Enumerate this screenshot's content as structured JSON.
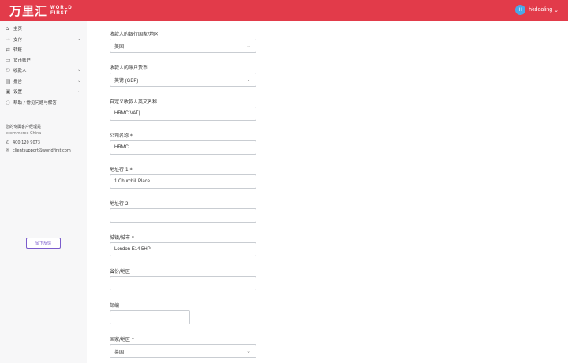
{
  "brand": {
    "cn": "万里汇",
    "en_line1": "WORLD",
    "en_line2": "FIRST"
  },
  "user": {
    "initial": "H",
    "name": "hkdealing"
  },
  "sidebar": {
    "items": [
      {
        "label": "主页",
        "icon": "home-icon",
        "glyph": "⌂",
        "has_arrow": false
      },
      {
        "label": "支付",
        "icon": "arrow-right-icon",
        "glyph": "→",
        "has_arrow": true
      },
      {
        "label": "转账",
        "icon": "transfer-icon",
        "glyph": "⇄",
        "has_arrow": false
      },
      {
        "label": "货币账户",
        "icon": "wallet-icon",
        "glyph": "▭",
        "has_arrow": false
      },
      {
        "label": "收款人",
        "icon": "person-icon",
        "glyph": "⚇",
        "has_arrow": true
      },
      {
        "label": "报告",
        "icon": "report-icon",
        "glyph": "▤",
        "has_arrow": true
      },
      {
        "label": "设置",
        "icon": "settings-icon",
        "glyph": "▣",
        "has_arrow": true
      },
      {
        "label": "帮助 / 常见问题与解答",
        "icon": "help-icon",
        "glyph": "◌",
        "has_arrow": false
      }
    ],
    "manager_title": "您的专属客户经理是",
    "manager_team": "ecommerce China",
    "manager_phone": "400 120 9073",
    "manager_email": "clientsupport@worldfirst.com",
    "feedback_label": "留下反馈"
  },
  "form": {
    "bank_country": {
      "label": "收款人的银行国家/地区",
      "value": "美国"
    },
    "currency": {
      "label": "收款人的账户货币",
      "value": "英镑 (GBP)"
    },
    "nickname": {
      "label": "自定义收款人英文名称",
      "value": "HRMC VAT|"
    },
    "company": {
      "label": "公司名称 *",
      "value": "HRMC"
    },
    "address1": {
      "label": "地址行 1 *",
      "value": "1 Churchill Place"
    },
    "address2": {
      "label": "地址行 2",
      "value": ""
    },
    "city": {
      "label": "城镇/城市 *",
      "value": "London E14 5HP"
    },
    "province": {
      "label": "省份/地区",
      "value": ""
    },
    "postcode": {
      "label": "邮编",
      "value": ""
    },
    "country": {
      "label": "国家/地区 *",
      "value": "英国"
    }
  },
  "colors": {
    "topbar": "#e23b4a",
    "accent": "#7b5ccc",
    "avatar": "#4aa8e8"
  }
}
